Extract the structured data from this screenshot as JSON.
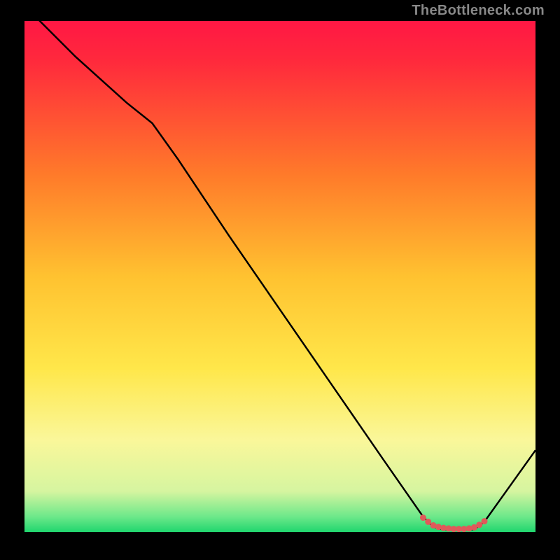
{
  "watermark": "TheBottleneck.com",
  "chart_data": {
    "type": "line",
    "title": "",
    "xlabel": "",
    "ylabel": "",
    "xlim": [
      0,
      100
    ],
    "ylim": [
      0,
      100
    ],
    "gradient_stops": [
      {
        "offset": 0.0,
        "color": "#ff1744"
      },
      {
        "offset": 0.08,
        "color": "#ff2a3c"
      },
      {
        "offset": 0.3,
        "color": "#ff7a2a"
      },
      {
        "offset": 0.5,
        "color": "#ffc230"
      },
      {
        "offset": 0.68,
        "color": "#ffe74a"
      },
      {
        "offset": 0.82,
        "color": "#faf79a"
      },
      {
        "offset": 0.92,
        "color": "#d6f5a0"
      },
      {
        "offset": 0.97,
        "color": "#6de88a"
      },
      {
        "offset": 1.0,
        "color": "#20d66e"
      }
    ],
    "series": [
      {
        "name": "bottleneck-curve",
        "x": [
          0,
          10,
          20,
          25,
          30,
          40,
          50,
          60,
          70,
          78,
          80,
          82,
          84,
          86,
          88,
          90,
          100
        ],
        "values": [
          103,
          93,
          84,
          80,
          73,
          58,
          43.5,
          29,
          14.5,
          3,
          1,
          0.5,
          0.5,
          0.5,
          0.5,
          2,
          16
        ]
      }
    ],
    "markers": {
      "name": "sweet-spot-band",
      "x": [
        78,
        79,
        80,
        81,
        82,
        83,
        84,
        85,
        86,
        87,
        88,
        89,
        90
      ],
      "values": [
        2.8,
        2.0,
        1.3,
        1.0,
        0.8,
        0.7,
        0.6,
        0.6,
        0.6,
        0.7,
        0.9,
        1.4,
        2.1
      ]
    },
    "marker_color": "#e05a5a",
    "line_color": "#000000"
  }
}
